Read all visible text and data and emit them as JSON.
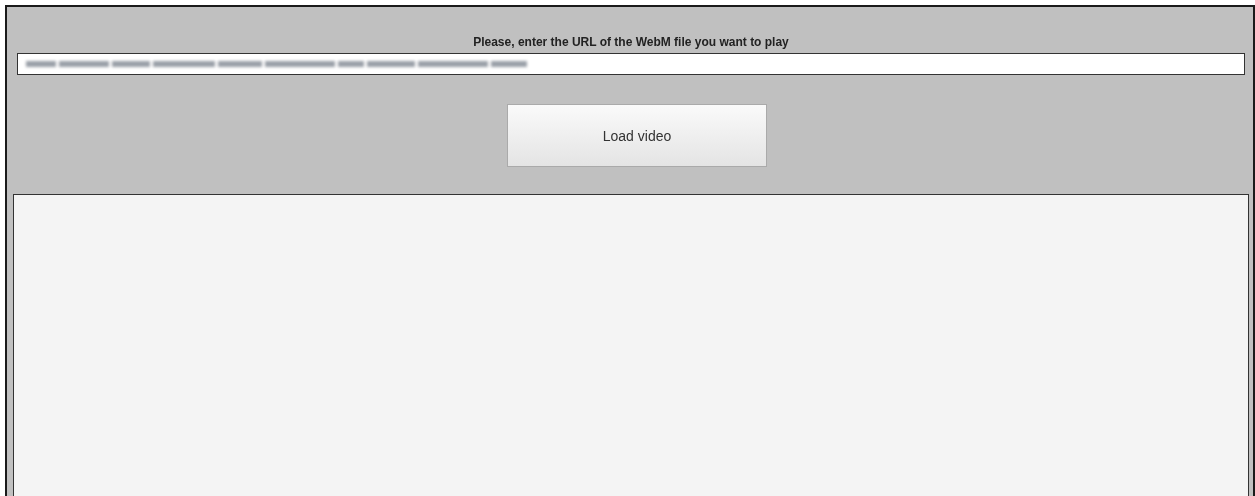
{
  "url_prompt": "Please, enter the URL of the WebM file you want to play",
  "url_field": {
    "redacted": true
  },
  "load_button": {
    "label": "Load video"
  }
}
